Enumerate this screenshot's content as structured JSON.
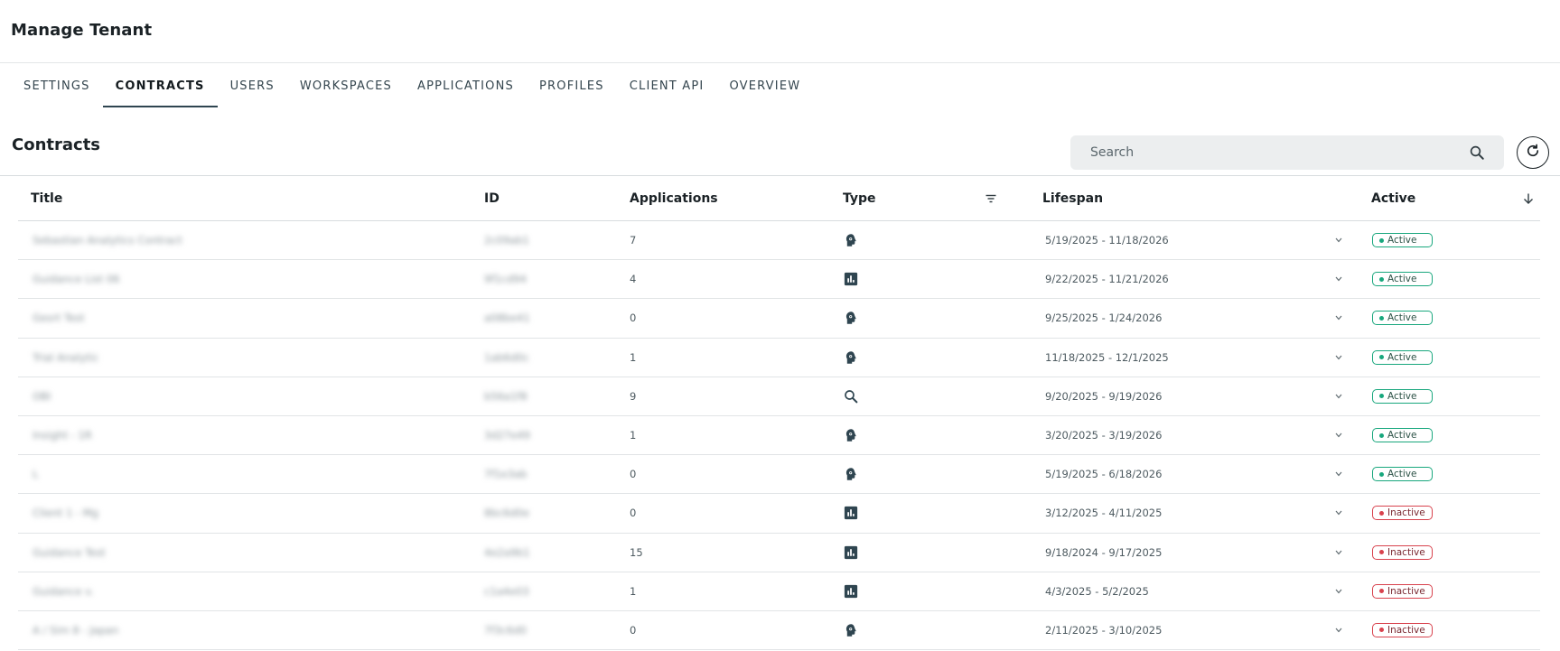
{
  "page": {
    "title": "Manage Tenant"
  },
  "tabs": [
    {
      "label": "SETTINGS",
      "active": false
    },
    {
      "label": "CONTRACTS",
      "active": true
    },
    {
      "label": "USERS",
      "active": false
    },
    {
      "label": "WORKSPACES",
      "active": false
    },
    {
      "label": "APPLICATIONS",
      "active": false
    },
    {
      "label": "PROFILES",
      "active": false
    },
    {
      "label": "CLIENT API",
      "active": false
    },
    {
      "label": "OVERVIEW",
      "active": false
    }
  ],
  "section": {
    "title": "Contracts"
  },
  "search": {
    "placeholder": "Search",
    "value": "",
    "icon": "search-icon"
  },
  "refresh": {
    "icon": "refresh-icon"
  },
  "columns": {
    "title": "Title",
    "id": "ID",
    "applications": "Applications",
    "type": "Type",
    "lifespan": "Lifespan",
    "active": "Active"
  },
  "icons": {
    "type_filter": "filter-icon",
    "sort": "arrow-down-icon",
    "expand": "chevron-down-icon"
  },
  "colors": {
    "active": "#18a77d",
    "inactive": "#d8424d",
    "icon_dark": "#2f4550"
  },
  "rows": [
    {
      "title": "Sebastian Analytics Contract",
      "id": "2c09ab1",
      "applications": "7",
      "type": "ai-head-icon",
      "lifespan": "5/19/2025 - 11/18/2026",
      "status": "Active"
    },
    {
      "title": "Guidance List 06",
      "id": "9f1cd94",
      "applications": "4",
      "type": "bar-chart-icon",
      "lifespan": "9/22/2025 - 11/21/2026",
      "status": "Active"
    },
    {
      "title": "Gesrt Test",
      "id": "a08be41",
      "applications": "0",
      "type": "ai-head-icon",
      "lifespan": "9/25/2025 - 1/24/2026",
      "status": "Active"
    },
    {
      "title": "Trial Analytic",
      "id": "1ab6d0c",
      "applications": "1",
      "type": "ai-head-icon",
      "lifespan": "11/18/2025 - 12/1/2025",
      "status": "Active"
    },
    {
      "title": "OBI",
      "id": "b56a1f8",
      "applications": "9",
      "type": "search-icon",
      "lifespan": "9/20/2025 - 9/19/2026",
      "status": "Active"
    },
    {
      "title": "Insight - 1R",
      "id": "3d27e49",
      "applications": "1",
      "type": "ai-head-icon",
      "lifespan": "3/20/2025 - 3/19/2026",
      "status": "Active"
    },
    {
      "title": "L",
      "id": "7f1e3ab",
      "applications": "0",
      "type": "ai-head-icon",
      "lifespan": "5/19/2025 - 6/18/2026",
      "status": "Active"
    },
    {
      "title": "Client 1 - Mg",
      "id": "8bc6d0e",
      "applications": "0",
      "type": "bar-chart-icon",
      "lifespan": "3/12/2025 - 4/11/2025",
      "status": "Inactive"
    },
    {
      "title": "Guidance Test",
      "id": "4e2a9b1",
      "applications": "15",
      "type": "bar-chart-icon",
      "lifespan": "9/18/2024 - 9/17/2025",
      "status": "Inactive"
    },
    {
      "title": "Guidance v.",
      "id": "c1a4e03",
      "applications": "1",
      "type": "bar-chart-icon",
      "lifespan": "4/3/2025 - 5/2/2025",
      "status": "Inactive"
    },
    {
      "title": "A / Sim 8 - Japan",
      "id": "7f3c6d0",
      "applications": "0",
      "type": "ai-head-icon",
      "lifespan": "2/11/2025 - 3/10/2025",
      "status": "Inactive"
    }
  ]
}
